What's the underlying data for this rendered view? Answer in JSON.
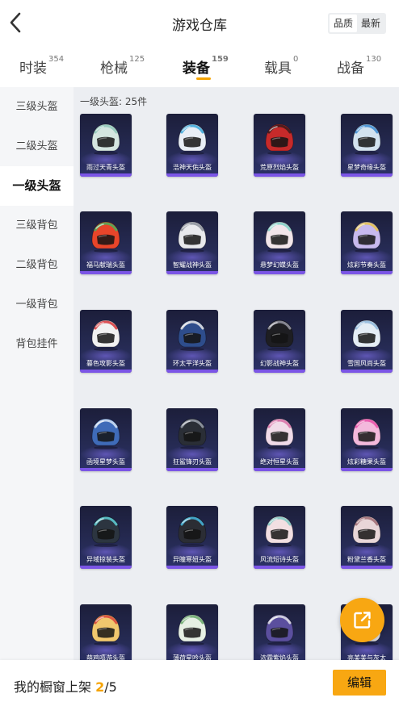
{
  "header": {
    "title": "游戏仓库",
    "seg_quality": "品质",
    "seg_newest": "最新"
  },
  "tabs": [
    {
      "label": "时装",
      "count": "354"
    },
    {
      "label": "枪械",
      "count": "125"
    },
    {
      "label": "装备",
      "count": "159"
    },
    {
      "label": "载具",
      "count": "0"
    },
    {
      "label": "战备",
      "count": "130"
    }
  ],
  "menu": [
    "三级头盔",
    "二级头盔",
    "一级头盔",
    "三级背包",
    "二级背包",
    "一级背包",
    "背包挂件"
  ],
  "section_label": "一级头盔: 25件",
  "items": [
    {
      "name": "雨过天青头盔",
      "color": "#d4e6e0",
      "accent": "#8fc7b8"
    },
    {
      "name": "浩神天佑头盔",
      "color": "#e8eef6",
      "accent": "#3aa7d9"
    },
    {
      "name": "荒原烈焰头盔",
      "color": "#c62a2a",
      "accent": "#3a1a1a"
    },
    {
      "name": "星梦奇缘头盔",
      "color": "#d2e2ef",
      "accent": "#3b8ad0"
    },
    {
      "name": "福马献瑞头盔",
      "color": "#e8452a",
      "accent": "#4bb05a"
    },
    {
      "name": "智耀战神头盔",
      "color": "#e8e9ec",
      "accent": "#8a8f9a"
    },
    {
      "name": "悬梦幻蝶头盔",
      "color": "#f2e6ea",
      "accent": "#7fd0c5"
    },
    {
      "name": "炫彩节奏头盔",
      "color": "#c7b9ee",
      "accent": "#e6c34a"
    },
    {
      "name": "暮色攻影头盔",
      "color": "#f1f1f1",
      "accent": "#d8363a"
    },
    {
      "name": "环太平洋头盔",
      "color": "#2e4d8c",
      "accent": "#e8e8e8"
    },
    {
      "name": "幻影战神头盔",
      "color": "#1e1e22",
      "accent": "#9a9aa6"
    },
    {
      "name": "雪国风尚头盔",
      "color": "#e4edf5",
      "accent": "#8fb7dc"
    },
    {
      "name": "函境星梦头盔",
      "color": "#3f6bb8",
      "accent": "#d6e4f6"
    },
    {
      "name": "狂鲨锋刃头盔",
      "color": "#2a2e36",
      "accent": "#9aa0ab"
    },
    {
      "name": "绝对恒星头盔",
      "color": "#f0dbe8",
      "accent": "#d86ea6"
    },
    {
      "name": "炫彩糖果头盔",
      "color": "#f3b9dc",
      "accent": "#e84fa8"
    },
    {
      "name": "异域掠装头盔",
      "color": "#2c3540",
      "accent": "#5fd0d8"
    },
    {
      "name": "异瞳寒妞头盔",
      "color": "#2b2d34",
      "accent": "#47b8e0"
    },
    {
      "name": "风流短诗头盔",
      "color": "#f2dfe2",
      "accent": "#7fc9c3"
    },
    {
      "name": "粉黛兰香头盔",
      "color": "#e8d6d8",
      "accent": "#9e6a72"
    },
    {
      "name": "萌鸡嘻游头盔",
      "color": "#f1c86e",
      "accent": "#d8433a"
    },
    {
      "name": "薄荷星吟头盔",
      "color": "#e6f0e4",
      "accent": "#67a86a"
    },
    {
      "name": "浓霜紫焰头盔",
      "color": "#5b4f9e",
      "accent": "#e0e0e8"
    },
    {
      "name": "亮美美与灰太",
      "color": "#e9e9ee",
      "accent": "#f0a200"
    }
  ],
  "bottom": {
    "label": "我的橱窗上架",
    "current": "2",
    "total": "/5",
    "edit": "编辑"
  },
  "colors": {
    "accent": "#f8a712",
    "card_bar": "#7b55e6"
  }
}
